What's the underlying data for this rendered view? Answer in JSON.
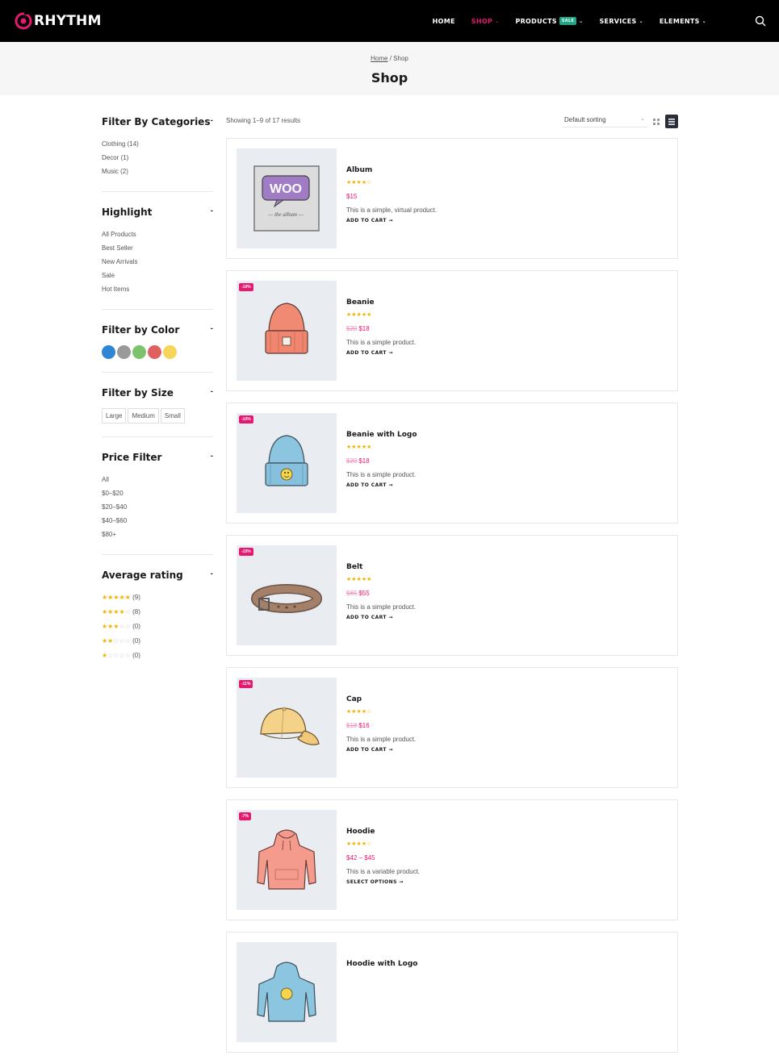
{
  "brand": {
    "name": "RHYTHM",
    "accent": "#e6186f"
  },
  "nav": {
    "items": [
      {
        "label": "HOME"
      },
      {
        "label": "SHOP"
      },
      {
        "label": "PRODUCTS",
        "badge": "SALE"
      },
      {
        "label": "SERVICES"
      },
      {
        "label": "ELEMENTS"
      }
    ]
  },
  "breadcrumb": {
    "home": "Home",
    "sep": "/",
    "current": "Shop"
  },
  "page": {
    "title": "Shop"
  },
  "sidebar": {
    "categories": {
      "title": "Filter By Categories",
      "items": [
        "Clothing (14)",
        "Decor (1)",
        "Music (2)"
      ]
    },
    "highlight": {
      "title": "Highlight",
      "items": [
        "All Products",
        "Best Seller",
        "New Arrivals",
        "Sale",
        "Hot Items"
      ]
    },
    "color": {
      "title": "Filter by Color",
      "swatches": [
        "#2e86d4",
        "#9a9a9a",
        "#7cc36c",
        "#e06060",
        "#f5d55a"
      ]
    },
    "size": {
      "title": "Filter by Size",
      "items": [
        "Large",
        "Medium",
        "Small"
      ]
    },
    "price": {
      "title": "Price Filter",
      "items": [
        "All",
        "$0–$20",
        "$20–$40",
        "$40–$60",
        "$80+"
      ]
    },
    "rating": {
      "title": "Average rating",
      "items": [
        {
          "stars": 5,
          "count": "(9)"
        },
        {
          "stars": 4,
          "count": "(8)"
        },
        {
          "stars": 3,
          "count": "(0)"
        },
        {
          "stars": 2,
          "count": "(0)"
        },
        {
          "stars": 1,
          "count": "(0)"
        }
      ]
    }
  },
  "toolbar": {
    "result_count": "Showing 1–9 of 17 results",
    "sort": "Default sorting"
  },
  "products": [
    {
      "name": "Album",
      "stars": 4,
      "old_price": "",
      "price": "$15",
      "desc": "This is a simple, virtual product.",
      "cta": "ADD TO CART →",
      "badge": "",
      "icon": "album"
    },
    {
      "name": "Beanie",
      "stars": 5,
      "old_price": "$20",
      "price": "$18",
      "desc": "This is a simple product.",
      "cta": "ADD TO CART →",
      "badge": "-10%",
      "icon": "beanie"
    },
    {
      "name": "Beanie with Logo",
      "stars": 5,
      "old_price": "$20",
      "price": "$18",
      "desc": "This is a simple product.",
      "cta": "ADD TO CART →",
      "badge": "-10%",
      "icon": "beanie-logo"
    },
    {
      "name": "Belt",
      "stars": 5,
      "old_price": "$65",
      "price": "$55",
      "desc": "This is a simple product.",
      "cta": "ADD TO CART →",
      "badge": "-15%",
      "icon": "belt"
    },
    {
      "name": "Cap",
      "stars": 4,
      "old_price": "$18",
      "price": "$16",
      "desc": "This is a simple product.",
      "cta": "ADD TO CART →",
      "badge": "-11%",
      "icon": "cap"
    },
    {
      "name": "Hoodie",
      "stars": 4,
      "old_price": "",
      "price": "$42 – $45",
      "desc": "This is a variable product.",
      "cta": "SELECT OPTIONS →",
      "badge": "-7%",
      "icon": "hoodie"
    },
    {
      "name": "Hoodie with Logo",
      "stars": 0,
      "old_price": "",
      "price": "",
      "desc": "",
      "cta": "",
      "badge": "",
      "icon": "hoodie-logo"
    }
  ]
}
